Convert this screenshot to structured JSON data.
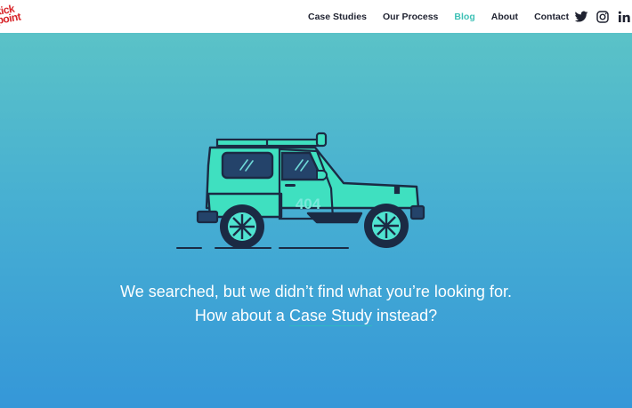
{
  "header": {
    "logo": {
      "line1": "kick",
      "line2": "point"
    },
    "nav": [
      {
        "label": "Case Studies"
      },
      {
        "label": "Our Process"
      },
      {
        "label": "Blog",
        "active": true
      },
      {
        "label": "About"
      },
      {
        "label": "Contact"
      }
    ],
    "social": [
      "twitter-icon",
      "instagram-icon",
      "linkedin-icon"
    ]
  },
  "illustration": {
    "door_text": "404"
  },
  "message": {
    "line1": "We searched, but we didn’t find what you’re looking for.",
    "line2_prefix": "How about a",
    "link": "Case Study",
    "line2_suffix": "instead?"
  },
  "colors": {
    "brand_red": "#d8262a",
    "active_nav": "#3fc1b6",
    "nav_text": "#1f2230",
    "bg_top": "#5ec6c5",
    "bg_bottom": "#3597d8",
    "jeep_body": "#3fe0c0",
    "jeep_outline": "#1b2a44"
  }
}
